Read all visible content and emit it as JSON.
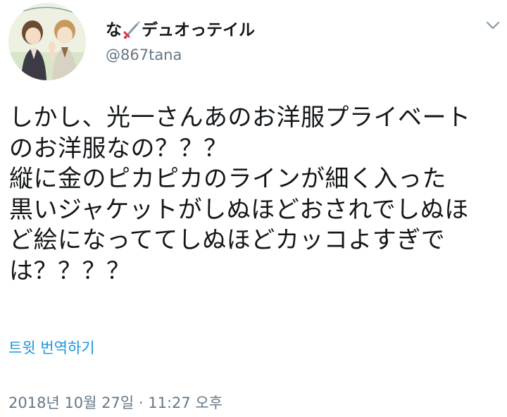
{
  "tweet": {
    "author": {
      "name_before_icon": "な",
      "name_icon": "sword-icon",
      "name_after_icon": "デュオっテイル",
      "handle": "@867tana",
      "avatar_icon": "avatar-illustration"
    },
    "body": "しかし、光一さんあのお洋服プライベート\nのお洋服なの？？？\n縦に金のピカピカのラインが細く入った\n黒いジャケットがしぬほどおされでしぬほ\nど絵になっててしぬほどカッコよすぎでは？？？？",
    "translate_label": "트윗 번역하기",
    "timestamp": "2018년 10월 27일 · 11:27 오후"
  },
  "menu_icon": "chevron-down-icon",
  "colors": {
    "text": "#14171a",
    "secondary": "#657786",
    "link": "#1b95e0",
    "background": "#ffffff"
  }
}
